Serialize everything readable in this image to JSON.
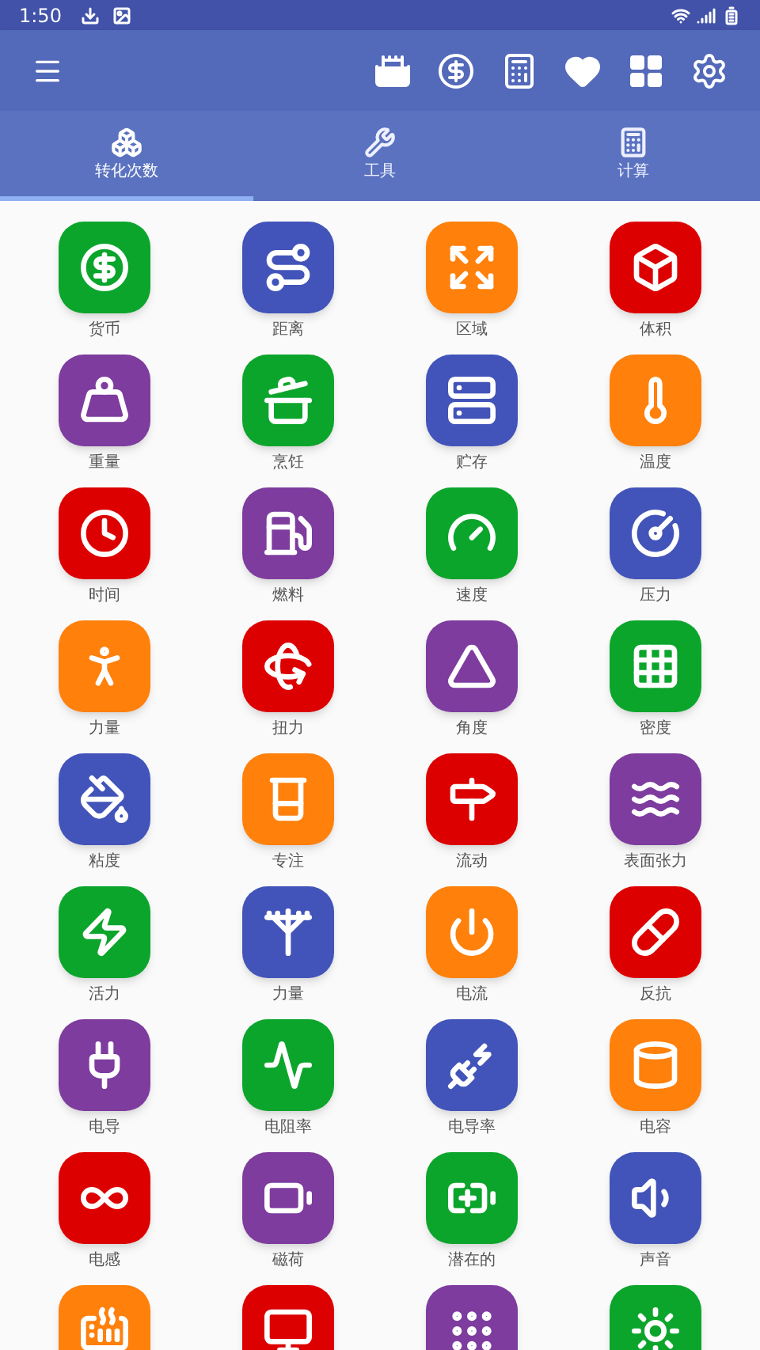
{
  "status_bar": {
    "time": "1:50"
  },
  "tabs": [
    {
      "label": "转化次数",
      "selected": true
    },
    {
      "label": "工具",
      "selected": false
    },
    {
      "label": "计算",
      "selected": false
    }
  ],
  "grid": {
    "items": [
      {
        "label": "货币",
        "color": "#0ca52c"
      },
      {
        "label": "距离",
        "color": "#4254b9"
      },
      {
        "label": "区域",
        "color": "#ff800b"
      },
      {
        "label": "体积",
        "color": "#dd0000"
      },
      {
        "label": "重量",
        "color": "#7d3c9e"
      },
      {
        "label": "烹饪",
        "color": "#0ca52c"
      },
      {
        "label": "贮存",
        "color": "#4254b9"
      },
      {
        "label": "温度",
        "color": "#ff800b"
      },
      {
        "label": "时间",
        "color": "#dd0000"
      },
      {
        "label": "燃料",
        "color": "#7d3c9e"
      },
      {
        "label": "速度",
        "color": "#0ca52c"
      },
      {
        "label": "压力",
        "color": "#4254b9"
      },
      {
        "label": "力量",
        "color": "#ff800b"
      },
      {
        "label": "扭力",
        "color": "#dd0000"
      },
      {
        "label": "角度",
        "color": "#7d3c9e"
      },
      {
        "label": "密度",
        "color": "#0ca52c"
      },
      {
        "label": "粘度",
        "color": "#4254b9"
      },
      {
        "label": "专注",
        "color": "#ff800b"
      },
      {
        "label": "流动",
        "color": "#dd0000"
      },
      {
        "label": "表面张力",
        "color": "#7d3c9e"
      },
      {
        "label": "活力",
        "color": "#0ca52c"
      },
      {
        "label": "力量",
        "color": "#4254b9"
      },
      {
        "label": "电流",
        "color": "#ff800b"
      },
      {
        "label": "反抗",
        "color": "#dd0000"
      },
      {
        "label": "电导",
        "color": "#7d3c9e"
      },
      {
        "label": "电阻率",
        "color": "#0ca52c"
      },
      {
        "label": "电导率",
        "color": "#4254b9"
      },
      {
        "label": "电容",
        "color": "#ff800b"
      },
      {
        "label": "电感",
        "color": "#dd0000"
      },
      {
        "label": "磁荷",
        "color": "#7d3c9e"
      },
      {
        "label": "潜在的",
        "color": "#0ca52c"
      },
      {
        "label": "声音",
        "color": "#4254b9"
      },
      {
        "color": "#ff800b"
      },
      {
        "color": "#dd0000"
      },
      {
        "color": "#7d3c9e"
      },
      {
        "color": "#0ca52c"
      }
    ]
  }
}
